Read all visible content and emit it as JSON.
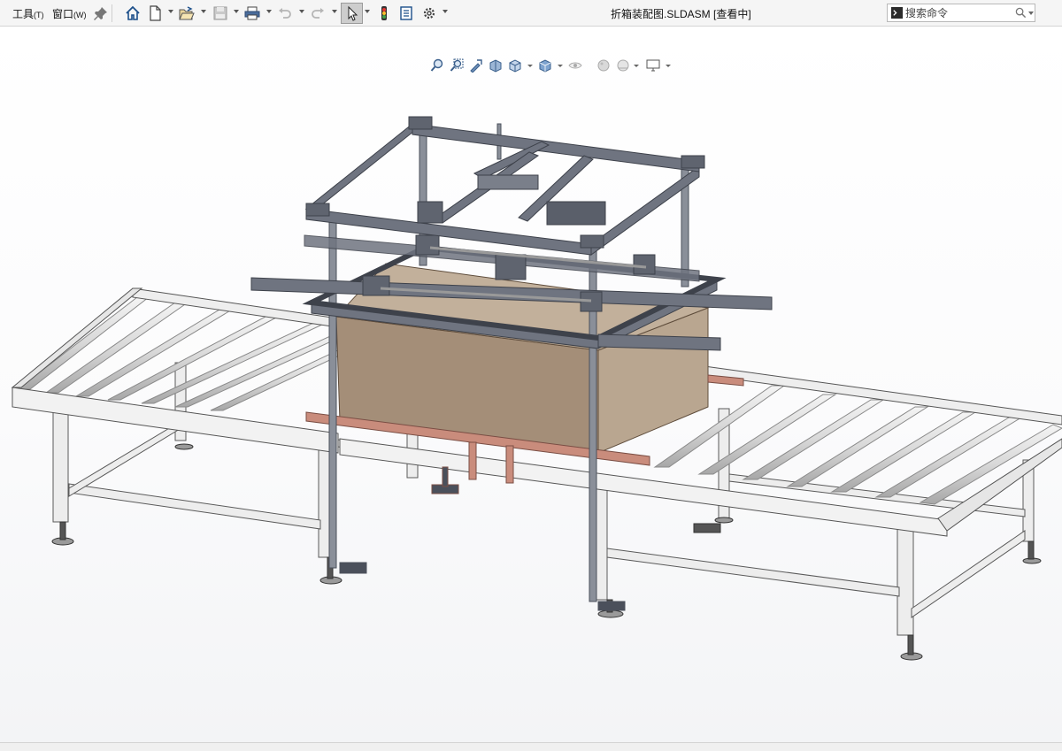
{
  "menu": {
    "tools_label": "工具",
    "tools_key": "(T)",
    "window_label": "窗口",
    "window_key": "(W)"
  },
  "document": {
    "title": "折箱装配图.SLDASM [查看中]"
  },
  "search": {
    "placeholder": "搜索命令"
  },
  "toolbar_icons": [
    "pin-icon",
    "home-icon",
    "new-document-icon",
    "open-icon",
    "save-icon",
    "print-icon",
    "undo-icon",
    "redo-icon",
    "select-icon",
    "rebuild-icon",
    "file-properties-icon",
    "options-icon"
  ],
  "heads_up_icons": [
    "zoom-to-fit-icon",
    "zoom-to-area-icon",
    "previous-view-icon",
    "section-view-icon",
    "view-orientation-icon",
    "display-style-icon",
    "hide-show-items-icon",
    "edit-appearance-icon",
    "apply-scene-icon",
    "view-settings-icon"
  ],
  "colors": {
    "frame_steel": "#6f7480",
    "frame_steel_dark": "#4b505b",
    "conveyor_white": "#eeeeee",
    "conveyor_edge": "#555555",
    "carton": "#a48e78",
    "carton_light": "#b9a690",
    "rail_copper": "#c98c7c"
  }
}
